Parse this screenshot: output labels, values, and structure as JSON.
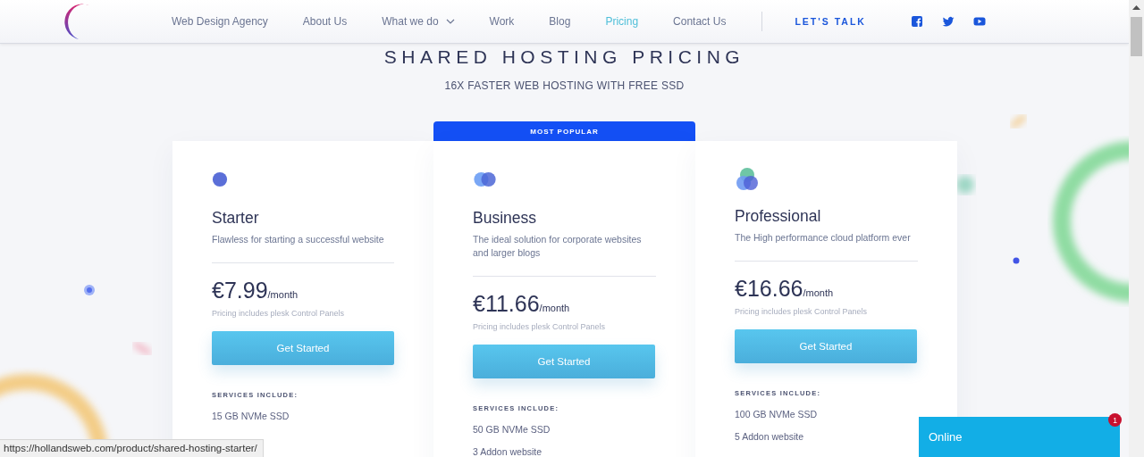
{
  "nav": {
    "items": [
      {
        "label": "Web Design Agency",
        "selected": false,
        "dropdown": false
      },
      {
        "label": "About Us",
        "selected": false,
        "dropdown": false
      },
      {
        "label": "What we do",
        "selected": false,
        "dropdown": true
      },
      {
        "label": "Work",
        "selected": false,
        "dropdown": false
      },
      {
        "label": "Blog",
        "selected": false,
        "dropdown": false
      },
      {
        "label": "Pricing",
        "selected": true,
        "dropdown": false
      },
      {
        "label": "Contact Us",
        "selected": false,
        "dropdown": false
      }
    ],
    "cta": "LET'S TALK",
    "social": [
      {
        "kind": "facebook"
      },
      {
        "kind": "twitter"
      },
      {
        "kind": "youtube"
      }
    ]
  },
  "heading": {
    "title": "SHARED HOSTING PRICING",
    "subtitle": "16X FASTER WEB HOSTING WITH FREE SSD"
  },
  "plans": [
    {
      "kind": "one",
      "name": "Starter",
      "description": "Flawless for starting a successful website",
      "price": "€7.99",
      "period": "/month",
      "note": "Pricing includes plesk Control Panels",
      "button": "Get Started",
      "services_label": "SERVICES INCLUDE:",
      "features": [
        "15 GB NVMe SSD"
      ]
    },
    {
      "kind": "two",
      "badge": "MOST POPULAR",
      "name": "Business",
      "description": "The ideal solution for corporate websites and larger blogs",
      "price": "€11.66",
      "period": "/month",
      "note": "Pricing includes plesk Control Panels",
      "button": "Get Started",
      "services_label": "SERVICES INCLUDE:",
      "features": [
        "50 GB NVMe SSD",
        "3 Addon website"
      ]
    },
    {
      "kind": "three",
      "name": "Professional",
      "description": "The High performance cloud platform ever",
      "price": "€16.66",
      "period": "/month",
      "note": "Pricing includes plesk Control Panels",
      "button": "Get Started",
      "services_label": "SERVICES INCLUDE:",
      "features": [
        "100 GB NVMe SSD",
        "5 Addon website"
      ]
    }
  ],
  "chat": {
    "label": "Online",
    "count": "1"
  },
  "status_bar": {
    "url": "https://hollandsweb.com/product/shared-hosting-starter/"
  }
}
